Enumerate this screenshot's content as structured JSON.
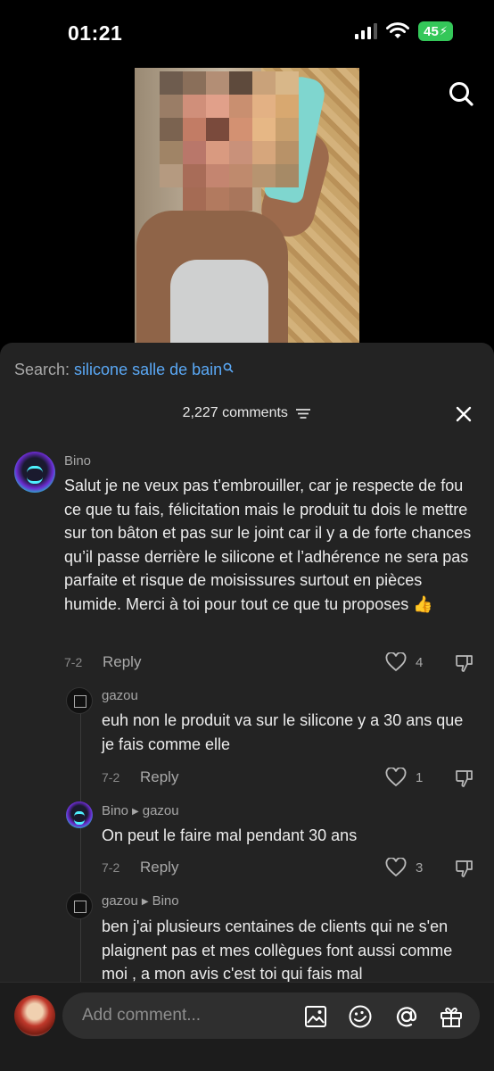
{
  "status_bar": {
    "time": "01:21",
    "battery": "45"
  },
  "search": {
    "prefix": "Search: ",
    "query": "silicone salle de bain"
  },
  "comments_header": {
    "count_label": "2,227 comments"
  },
  "comments": [
    {
      "username": "Bino",
      "text": "Salut je ne veux pas t’embrouiller, car je respecte de fou ce que tu fais, félicitation mais le produit tu dois le mettre sur ton bâton et pas sur le joint car il y a de forte chances qu’il passe derrière le silicone et l’adhérence ne sera pas parfaite et risque de moisissures surtout en pièces humide. Merci à toi pour tout ce que tu proposes 👍",
      "date": "7-2",
      "reply_label": "Reply",
      "likes": "4"
    },
    {
      "username": "gazou",
      "text": "euh non le produit va sur le silicone y a 30 ans que je fais comme elle",
      "date": "7-2",
      "reply_label": "Reply",
      "likes": "1"
    },
    {
      "username": "Bino",
      "reply_to": "gazou",
      "text": "On peut le faire mal pendant 30 ans",
      "date": "7-2",
      "reply_label": "Reply",
      "likes": "3"
    },
    {
      "username": "gazou",
      "reply_to": "Bino",
      "text": "ben j'ai plusieurs centaines de clients qui ne s'en plaignent pas et mes collègues font aussi comme moi , a mon avis c'est toi qui fais mal"
    }
  ],
  "comment_input": {
    "placeholder": "Add comment..."
  },
  "icons": [
    "search-icon",
    "sort-icon",
    "close-icon",
    "heart-icon",
    "dislike-icon",
    "image-icon",
    "emoji-icon",
    "mention-icon",
    "gift-icon"
  ],
  "colors": {
    "accent_link": "#5aa8f5",
    "sheet_bg": "#232323",
    "battery_green": "#34c759"
  }
}
